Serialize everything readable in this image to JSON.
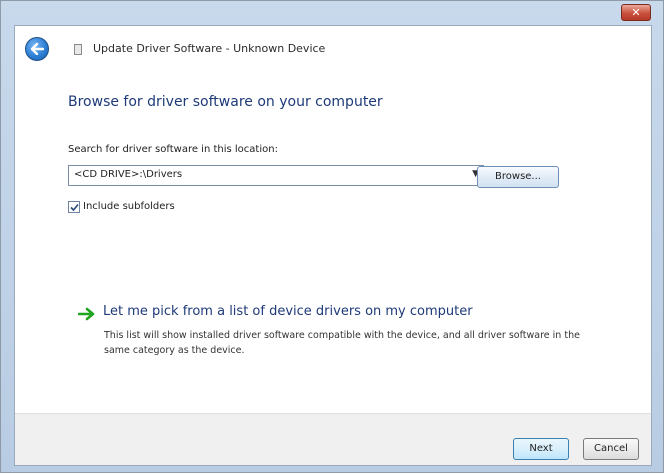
{
  "window": {
    "title": "Update Driver Software - Unknown Device",
    "close_label": "✕"
  },
  "page": {
    "heading": "Browse for driver software on your computer",
    "search_label": "Search for driver software in this location:",
    "path_value": "<CD DRIVE>:\\Drivers",
    "browse_label": "Browse...",
    "include_subfolders_label": "Include subfolders",
    "include_subfolders_checked": true
  },
  "pick": {
    "link_label": "Let me pick from a list of device drivers on my computer",
    "description": "This list will show installed driver software compatible with the device, and all driver software in the same category as the device."
  },
  "footer": {
    "next_label": "Next",
    "cancel_label": "Cancel"
  },
  "colors": {
    "heading": "#1e3a78",
    "link_arrow": "#1fa51f"
  },
  "icons": {
    "back": "back-arrow-icon",
    "title": "device-icon",
    "pick": "green-arrow-icon",
    "checkbox": "checkmark-icon"
  }
}
